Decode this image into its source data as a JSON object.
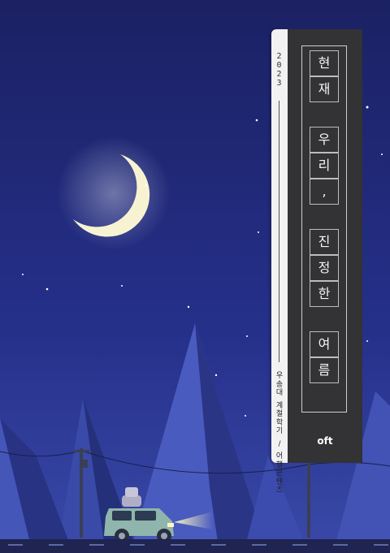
{
  "colors": {
    "sky_top": "#1b2163",
    "sky_bottom": "#3a49a8",
    "moon": "#f7f3d2",
    "cover_dark": "#333234",
    "spine_light": "#f2f2f2",
    "mountain_light": "#4a5bbf",
    "mountain_dark": "#25307a",
    "car": "#8fb5ad"
  },
  "spine": {
    "year_digits": [
      "2",
      "0",
      "2",
      "3"
    ],
    "meta_chars": [
      "우",
      "송",
      "대",
      " ",
      "계",
      "절",
      "학",
      "기",
      " ",
      "/",
      " ",
      "어",
      "행",
      "콘",
      "텐",
      "츠"
    ]
  },
  "title": {
    "text": "현재 우리, 진정한 여름",
    "chars": [
      "현",
      "재",
      "",
      "우",
      "리",
      ",",
      "",
      "진",
      "정",
      "한",
      "",
      "여",
      "름"
    ]
  },
  "publisher_logo": "oft"
}
